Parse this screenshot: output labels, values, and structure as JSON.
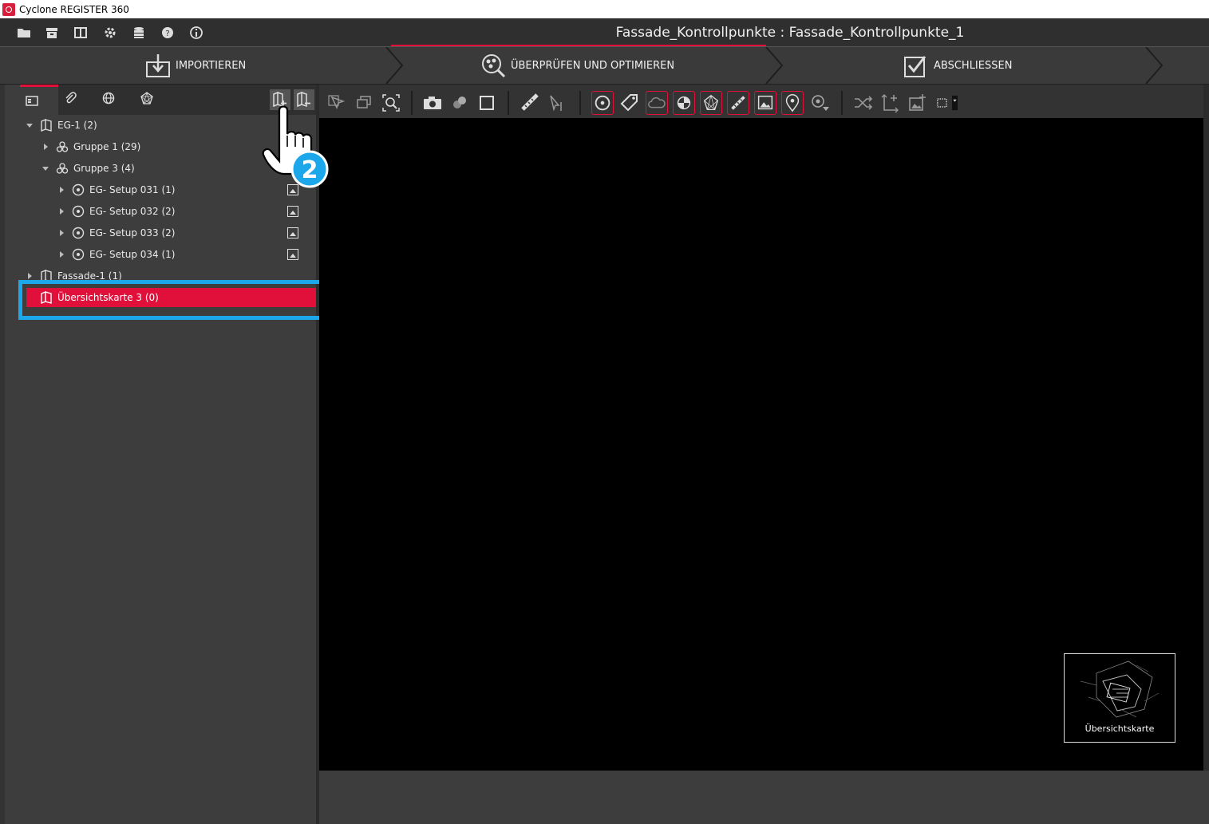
{
  "window": {
    "title": "Cyclone REGISTER 360"
  },
  "menubar": {
    "icons": [
      "open-folder-icon",
      "archive-icon",
      "book-icon",
      "gear-icon",
      "database-icon",
      "help-icon",
      "info-icon"
    ],
    "project_title": "Fassade_Kontrollpunkte : Fassade_Kontrollpunkte_1"
  },
  "workflow": {
    "steps": [
      {
        "label": "IMPORTIEREN",
        "icon": "import-icon"
      },
      {
        "label": "ÜBERPRÜFEN UND OPTIMIEREN",
        "icon": "review-icon",
        "active": true
      },
      {
        "label": "ABSCHLIESSEN",
        "icon": "finalize-icon"
      }
    ]
  },
  "panel_tabs": [
    "tree-tab-icon",
    "attachment-tab-icon",
    "globe-tab-icon",
    "network-tab-icon"
  ],
  "tree": {
    "items": [
      {
        "label": "EG-1 (2)"
      },
      {
        "label": "Gruppe 1 (29)"
      },
      {
        "label": "Gruppe 3 (4)"
      },
      {
        "label": "EG- Setup 031 (1)"
      },
      {
        "label": "EG- Setup 032 (2)"
      },
      {
        "label": "EG- Setup 033 (2)"
      },
      {
        "label": "EG- Setup 034 (1)"
      },
      {
        "label": "Fassade-1 (1)"
      },
      {
        "label": "Übersichtskarte 3 (0)",
        "selected": true
      }
    ]
  },
  "annotation": {
    "step_number": "2"
  },
  "overview_map": {
    "label": "Übersichtskarte"
  },
  "colors": {
    "accent": "#e0103a",
    "highlight": "#1ca7ea",
    "viewport": "#000000",
    "panel": "#3d3d3d"
  }
}
